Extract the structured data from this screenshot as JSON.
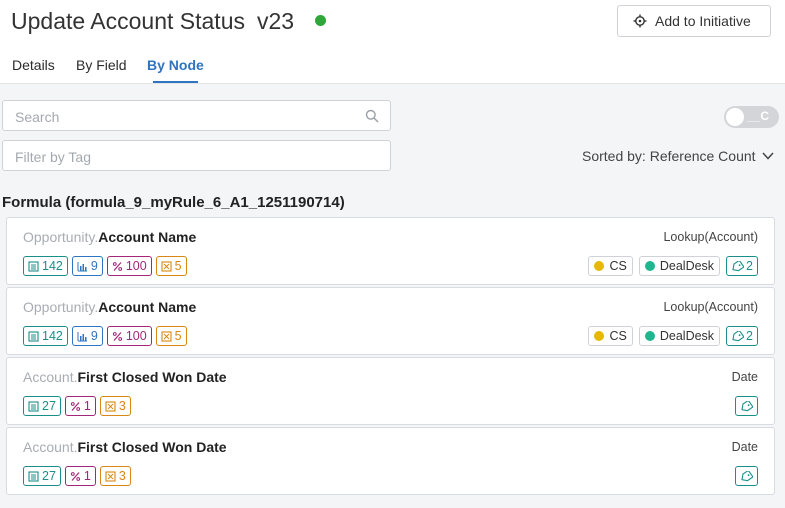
{
  "header": {
    "title": "Update Account Status",
    "version": "v23",
    "status_color": "#2ea63a",
    "add_button_label": "Add to Initiative"
  },
  "tabs": [
    {
      "label": "Details",
      "active": false
    },
    {
      "label": "By Field",
      "active": false
    },
    {
      "label": "By Node",
      "active": true
    }
  ],
  "filters": {
    "search_placeholder": "Search",
    "tag_placeholder": "Filter by Tag",
    "toggle_label": "__C",
    "toggle_on": false,
    "sorted_by": "Sorted by: Reference Count"
  },
  "formula": {
    "title": "Formula (formula_9_myRule_6_A1_1251190714)"
  },
  "cards": [
    {
      "object": "Opportunity",
      "field": "Account Name",
      "type": "Lookup(Account)",
      "badges": [
        {
          "icon": "page-layout-icon",
          "value": "142"
        },
        {
          "icon": "report-icon",
          "value": "9"
        },
        {
          "icon": "formula-icon",
          "value": "100"
        },
        {
          "icon": "automation-icon",
          "value": "5"
        }
      ],
      "tags": [
        {
          "label": "CS",
          "color": "#e6b800"
        },
        {
          "label": "DealDesk",
          "color": "#1fb58f"
        }
      ],
      "tag_count": "2"
    },
    {
      "object": "Opportunity",
      "field": "Account Name",
      "type": "Lookup(Account)",
      "badges": [
        {
          "icon": "page-layout-icon",
          "value": "142"
        },
        {
          "icon": "report-icon",
          "value": "9"
        },
        {
          "icon": "formula-icon",
          "value": "100"
        },
        {
          "icon": "automation-icon",
          "value": "5"
        }
      ],
      "tags": [
        {
          "label": "CS",
          "color": "#e6b800"
        },
        {
          "label": "DealDesk",
          "color": "#1fb58f"
        }
      ],
      "tag_count": "2"
    },
    {
      "object": "Account",
      "field": "First Closed Won Date",
      "type": "Date",
      "badges": [
        {
          "icon": "page-layout-icon",
          "value": "27"
        },
        {
          "icon": "formula-icon",
          "value": "1"
        },
        {
          "icon": "automation-icon",
          "value": "3"
        }
      ],
      "tags": [],
      "tag_count": ""
    },
    {
      "object": "Account",
      "field": "First Closed Won Date",
      "type": "Date",
      "badges": [
        {
          "icon": "page-layout-icon",
          "value": "27"
        },
        {
          "icon": "formula-icon",
          "value": "1"
        },
        {
          "icon": "automation-icon",
          "value": "3"
        }
      ],
      "tags": [],
      "tag_count": ""
    }
  ]
}
